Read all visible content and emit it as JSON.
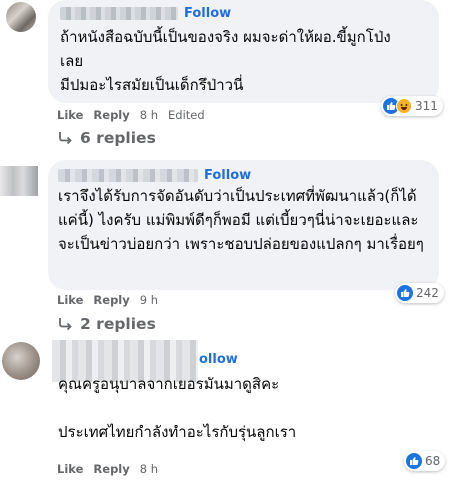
{
  "comments": [
    {
      "follow": "Follow",
      "text": "ถ้าหนังสือฉบับนี้เป็นของจริง ผมจะด่าให้ผอ.ขี้มูกโป่งเลย\nมีปมอะไรสมัยเป็นเด็กรึป่าวนี่",
      "like": "Like",
      "reply": "Reply",
      "time": "8 h",
      "edited": "Edited",
      "reaction_count": "311",
      "reaction_icons": [
        "like-icon",
        "haha-icon"
      ],
      "replies": "6 replies"
    },
    {
      "follow": "Follow",
      "text": "เราจึงได้รับการจัดอันดับว่าเป็นประเทศที่พัฒนาแล้ว(ก็ได้แค่นี้) ไงครับ แม่พิมพ์ดีๆก็พอมี แต่เบี้ยวๆนี่น่าจะเยอะและจะเป็นข่าวบ่อยกว่า เพราะชอบปล่อยของแปลกๆ มาเรื่อยๆ",
      "like": "Like",
      "reply": "Reply",
      "time": "9 h",
      "reaction_count": "242",
      "reaction_icons": [
        "like-icon"
      ],
      "replies": "2 replies"
    },
    {
      "follow": "ollow",
      "text": "คุณครูอนุบาลจากเยอรมันมาดูสิคะ\n\nประเทศไทยกำลังทำอะไรกับรุ่นลูกเรา",
      "like": "Like",
      "reply": "Reply",
      "time": "8 h",
      "reaction_count": "68",
      "reaction_icons": [
        "like-icon"
      ]
    }
  ],
  "colors": {
    "bubble": "#f0f2f5",
    "follow": "#216fdb",
    "meta": "#65676b",
    "like_blue": "#1b74e4",
    "haha_yellow": "#f7b125"
  }
}
